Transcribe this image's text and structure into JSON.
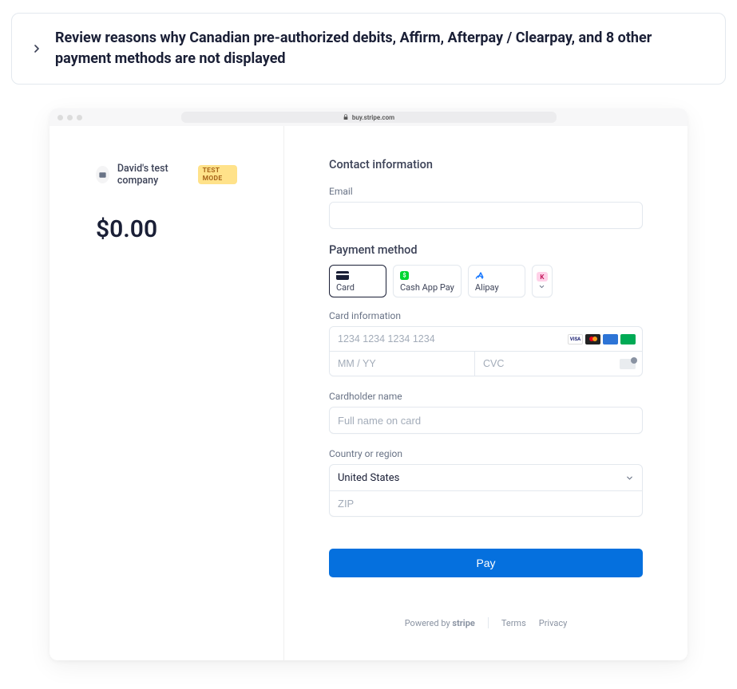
{
  "banner": {
    "text": "Review reasons why Canadian pre-authorized debits, Affirm, Afterpay / Clearpay, and 8 other payment methods are not displayed"
  },
  "browser": {
    "url": "buy.stripe.com"
  },
  "merchant": {
    "name": "David's test company",
    "badge": "TEST MODE"
  },
  "amount": "$0.00",
  "checkout": {
    "contact_heading": "Contact information",
    "email_label": "Email",
    "payment_method_heading": "Payment method",
    "methods": {
      "card": "Card",
      "cashapp": "Cash App Pay",
      "alipay": "Alipay",
      "more_badge": "K"
    },
    "card_info_label": "Card information",
    "card_number_placeholder": "1234 1234 1234 1234",
    "expiry_placeholder": "MM / YY",
    "cvc_placeholder": "CVC",
    "cardholder_label": "Cardholder name",
    "cardholder_placeholder": "Full name on card",
    "country_label": "Country or region",
    "country_value": "United States",
    "zip_placeholder": "ZIP",
    "pay_button": "Pay"
  },
  "footer": {
    "powered_by": "Powered by",
    "brand": "stripe",
    "terms": "Terms",
    "privacy": "Privacy"
  }
}
